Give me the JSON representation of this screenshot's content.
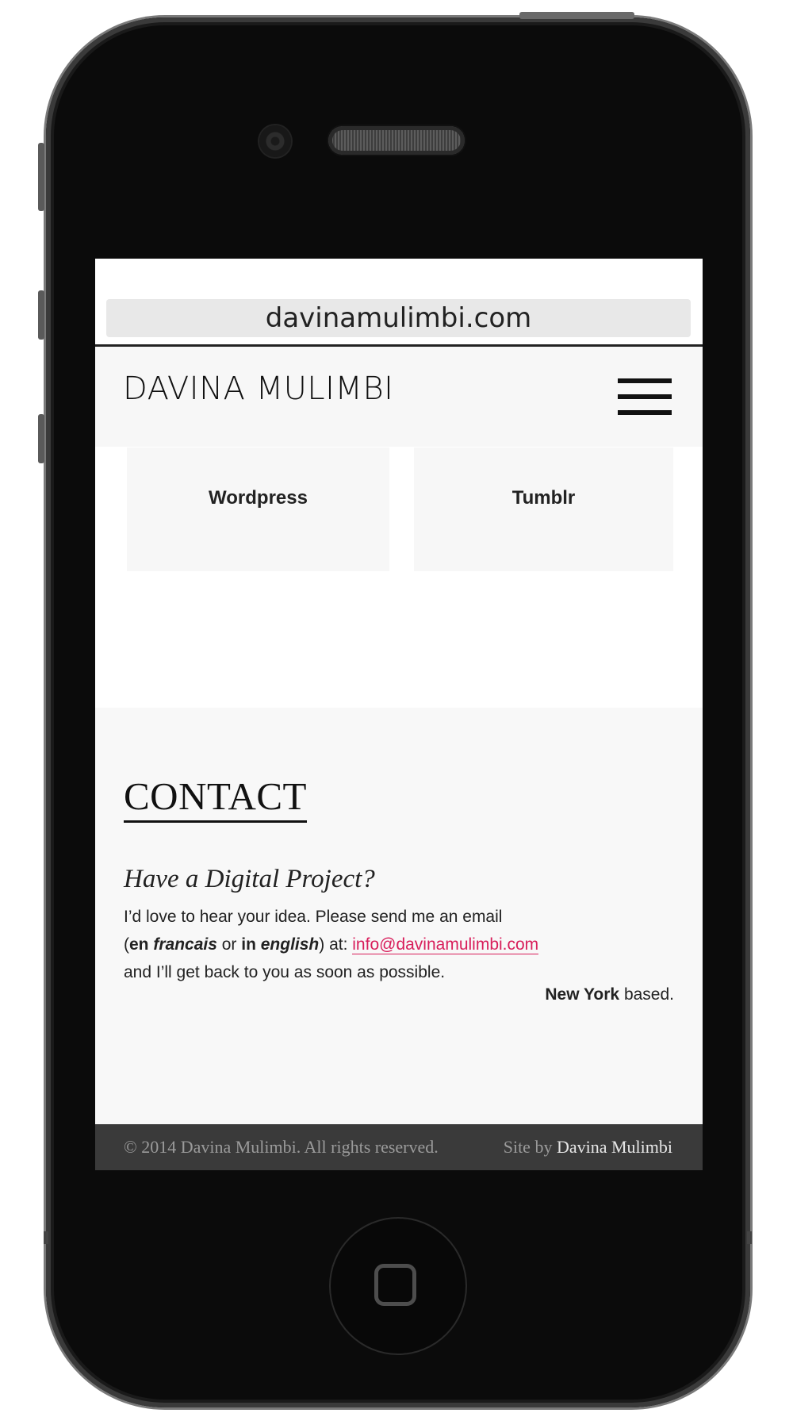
{
  "browser": {
    "url": "davinamulimbi.com"
  },
  "header": {
    "logo": "DAVINA MULIMBI"
  },
  "cards": [
    {
      "label": "Wordpress"
    },
    {
      "label": "Tumblr"
    }
  ],
  "contact": {
    "title": "CONTACT",
    "subtitle": "Have a Digital Project?",
    "line1": "I’d love to hear your idea. Please send me an email",
    "paren_open": "(",
    "en": "en ",
    "francais": "francais",
    "or": " or ",
    "in": "in ",
    "english": "english",
    "at": ") at: ",
    "email": "info@davinamulimbi.com",
    "line3": "and I’ll get back to you as soon as possible.",
    "based_city": "New York",
    "based_suffix": " based."
  },
  "footer": {
    "copyright": "© 2014 Davina Mulimbi. All rights reserved.",
    "siteby_prefix": "Site by ",
    "siteby_name": "Davina Mulimbi"
  },
  "colors": {
    "accent": "#d81e5b",
    "footer_bg": "#3a3a3a"
  }
}
